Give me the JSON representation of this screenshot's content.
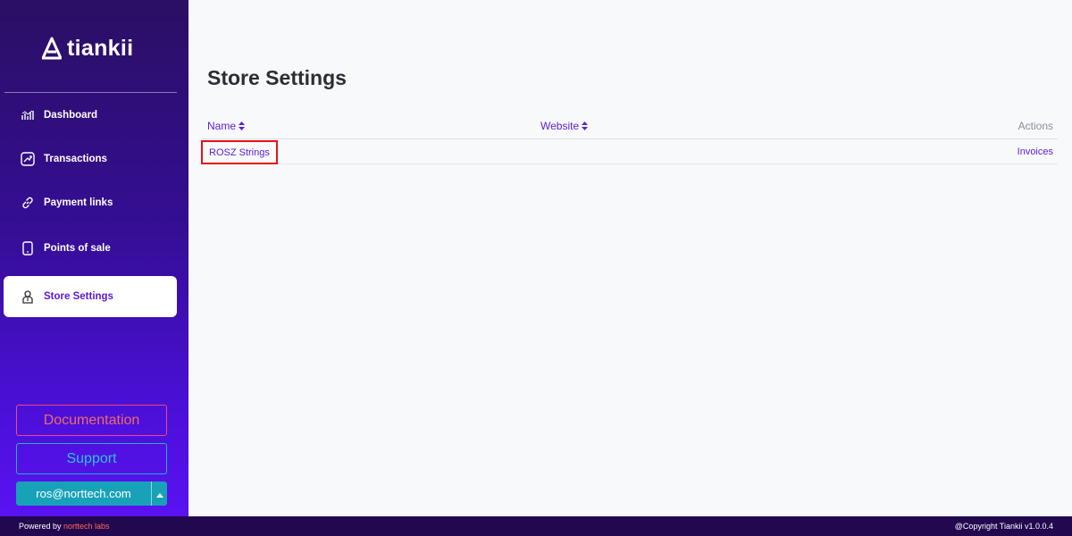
{
  "brand": {
    "logo_text": "tiankii"
  },
  "sidebar": {
    "items": [
      {
        "label": "Dashboard",
        "icon": "chart-icon",
        "active": false
      },
      {
        "label": "Transactions",
        "icon": "transactions-icon",
        "active": false
      },
      {
        "label": "Payment links",
        "icon": "link-icon",
        "active": false
      },
      {
        "label": "Points of sale",
        "icon": "phone-icon",
        "active": false
      },
      {
        "label": "Store Settings",
        "icon": "store-icon",
        "active": true
      }
    ],
    "documentation_label": "Documentation",
    "support_label": "Support",
    "user_email": "ros@norttech.com"
  },
  "main": {
    "title": "Store Settings",
    "table": {
      "columns": [
        "Name",
        "Website",
        "Actions"
      ],
      "rows": [
        {
          "name": "ROSZ Strings",
          "website": "",
          "action": "Invoices"
        }
      ]
    }
  },
  "footer": {
    "powered_prefix": "Powered by ",
    "powered_brand": "norttech labs",
    "copyright": "@Copyright Tiankii v1.0.0.4"
  },
  "colors": {
    "accent": "#5b20d6",
    "sidebar_top": "#2a0f63",
    "sidebar_bottom": "#5a12f2",
    "documentation": "#e94b83",
    "support": "#1ab6c9",
    "user_button": "#17a2b8",
    "highlight": "#e3121b"
  }
}
